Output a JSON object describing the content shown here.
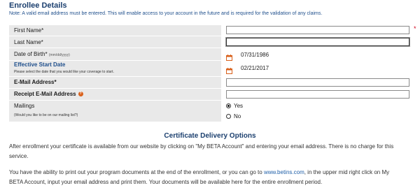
{
  "section": {
    "title": "Enrollee Details",
    "note": "Note: A valid email address must be entered. This will enable access to your account in the future and is required for the validation of any claims."
  },
  "form": {
    "first_name": {
      "label": "First Name*",
      "value": ""
    },
    "last_name": {
      "label": "Last Name*",
      "value": ""
    },
    "dob": {
      "label": "Date of Birth*",
      "format_hint": "(mm/dd/yyyy)",
      "value": "07/31/1986",
      "icon": "calendar-icon"
    },
    "start_date": {
      "label": "Effective Start Date",
      "help": "Please select the date that you would like your coverage to start.",
      "value": "02/21/2017",
      "icon": "calendar-icon"
    },
    "email": {
      "label": "E-Mail Address*",
      "value": ""
    },
    "receipt_email": {
      "label": "Receipt E-Mail Address",
      "value": "",
      "icon": "help-icon",
      "icon_glyph": "?"
    },
    "mailings": {
      "label": "Mailings",
      "help": "(Would you like to be on our mailing list?)",
      "options": [
        "Yes",
        "No"
      ],
      "selected": "Yes"
    },
    "required_marker": "*"
  },
  "certificate": {
    "title": "Certificate Delivery Options",
    "paragraph1": "After enrollment your certificate is available from our website by clicking on \"My BETA Account\" and entering your email address. There is no charge for this",
    "paragraph1_cont": "service.",
    "paragraph2_a": "You have the ability to print out your program documents at the end of the enrollment, or you can go to ",
    "paragraph2_link": "www.betins.com",
    "paragraph2_b": ", in the upper mid right click on My",
    "paragraph2_line2": "BETA Account, input your email address and print them. Your documents will be available here for the entire enrollment period."
  },
  "colors": {
    "heading": "#1b3f6e",
    "note": "#1f4f8c",
    "label_bg": "#e9e9e9",
    "required": "#d0021b",
    "calendar": "#d9611c",
    "link": "#1f5fa8"
  }
}
